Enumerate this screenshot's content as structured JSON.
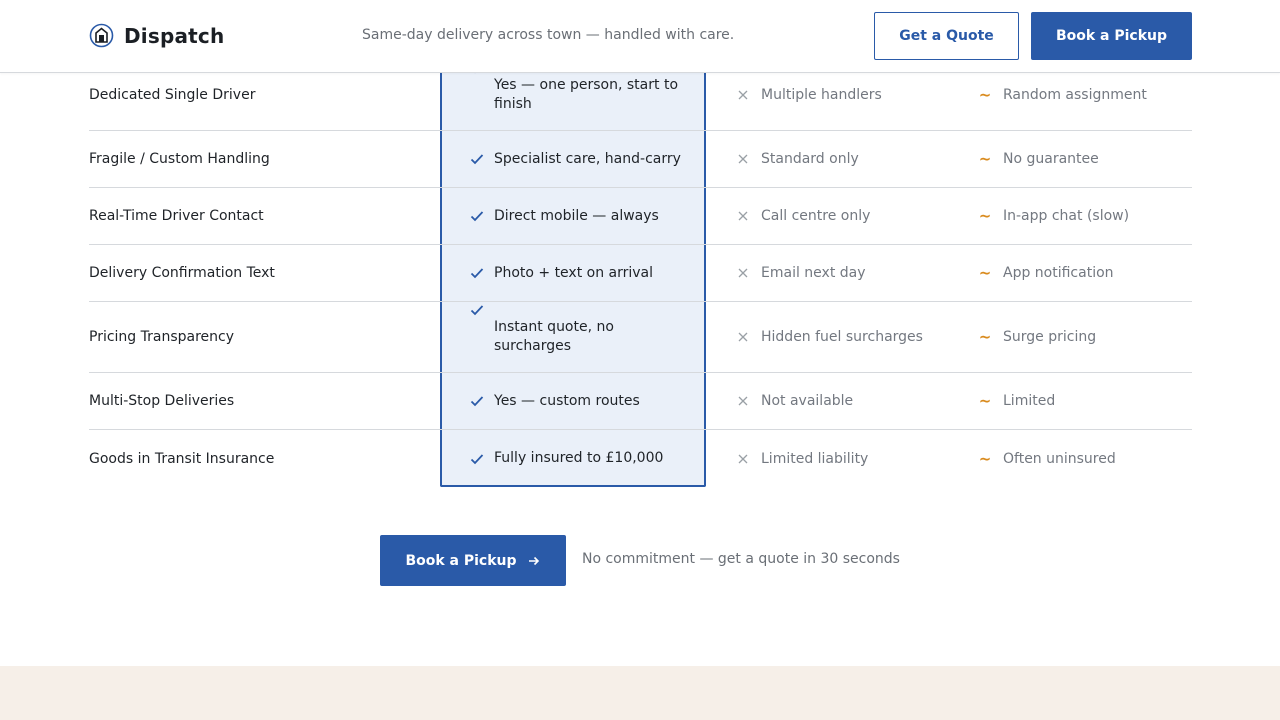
{
  "header": {
    "brand": "Dispatch",
    "tagline": "Same-day delivery across town — handled with care.",
    "quote_label": "Get a Quote",
    "pickup_label": "Book a Pickup"
  },
  "comparison": {
    "rows": [
      {
        "feature": "Dedicated Single Driver",
        "ours": "Yes — one person, start to finish",
        "other": "Multiple handlers",
        "third": "Random assignment"
      },
      {
        "feature": "Fragile / Custom Handling",
        "ours": "Specialist care, hand-carry",
        "other": "Standard only",
        "third": "No guarantee"
      },
      {
        "feature": "Real-Time Driver Contact",
        "ours": "Direct mobile — always",
        "other": "Call centre only",
        "third": "In-app chat (slow)"
      },
      {
        "feature": "Delivery Confirmation Text",
        "ours": "Photo + text on arrival",
        "other": "Email next day",
        "third": "App notification"
      },
      {
        "feature": "Pricing Transparency",
        "ours": "Instant quote, no surcharges",
        "other": "Hidden fuel surcharges",
        "third": "Surge pricing"
      },
      {
        "feature": "Multi-Stop Deliveries",
        "ours": "Yes — custom routes",
        "other": "Not available",
        "third": "Limited"
      },
      {
        "feature": "Goods in Transit Insurance",
        "ours": "Fully insured to £10,000",
        "other": "Limited liability",
        "third": "Often uninsured"
      }
    ]
  },
  "cta": {
    "button_label": "Book a Pickup",
    "note": "No commitment — get a quote in 30 seconds"
  },
  "icons": {
    "check": "check-icon",
    "cross": "cross-icon",
    "tilde": "tilde-icon",
    "tilde_glyph": "~",
    "arrow": "arrow-right-icon",
    "logo": "dispatch-logo-icon"
  },
  "colors": {
    "primary": "#2a5aa8",
    "highlight_bg": "#eaf0f9",
    "tilde": "#d98a1c",
    "muted_text": "#737880",
    "footer_band": "#f6efe8"
  }
}
